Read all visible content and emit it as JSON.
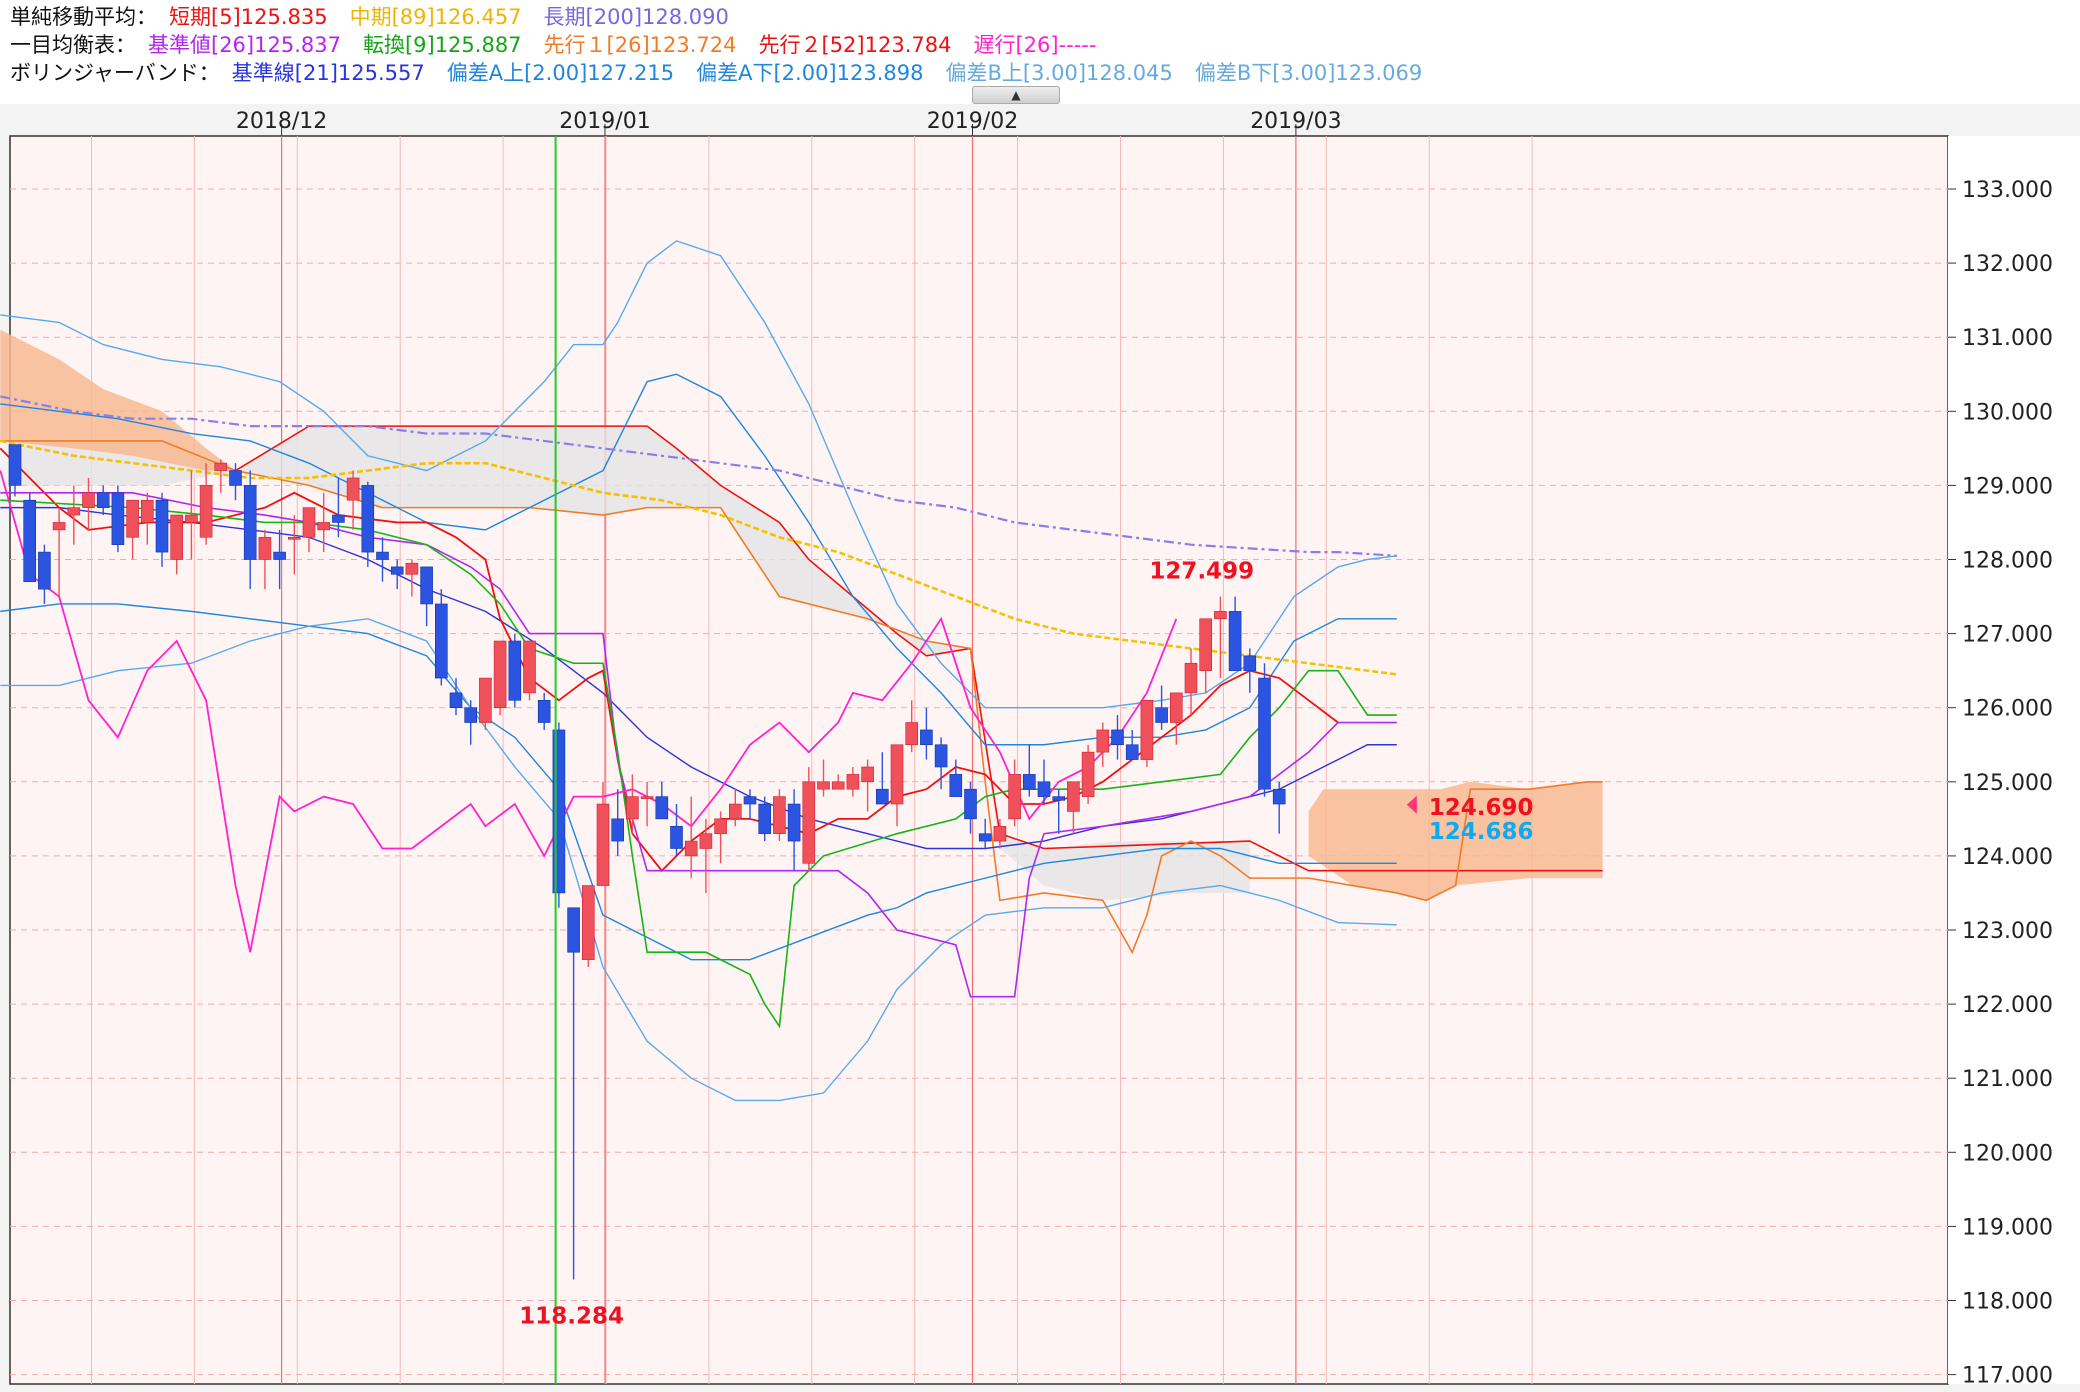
{
  "header": {
    "sma": {
      "label": "単純移動平均：",
      "short": "短期[5]125.835",
      "mid": "中期[89]126.457",
      "long": "長期[200]128.090"
    },
    "ichimoku": {
      "label": "一目均衡表：",
      "kijun": "基準値[26]125.837",
      "tenkan": "転換[9]125.887",
      "senkou1": "先行１[26]123.724",
      "senkou2": "先行２[52]123.784",
      "chikou": "遅行[26]-----"
    },
    "bollinger": {
      "label": "ボリンジャーバンド：",
      "base": "基準線[21]125.557",
      "a_up": "偏差A上[2.00]127.215",
      "a_down": "偏差A下[2.00]123.898",
      "b_up": "偏差B上[3.00]128.045",
      "b_down": "偏差B下[3.00]123.069"
    }
  },
  "colors": {
    "up": "#f0505a",
    "down": "#2b55e0",
    "sma_short": "#ee1111",
    "sma_mid": "#f5c000",
    "sma_long": "#8a7ee8",
    "kijun": "#b226ee",
    "tenkan": "#16b516",
    "senkou1": "#f07b28",
    "senkou2": "#ee1111",
    "chikou": "#ff22cc",
    "bb_base": "#2b33dd",
    "bb_a": "#1f86dd",
    "bb_b": "#55aaee",
    "cloud_bull": "#f8b890",
    "cloud_bear": "#e4e4e4",
    "bg": "#fff4f4",
    "grid": "#f4aaaa",
    "vline": "#f07070",
    "marker": "#22cc22",
    "lbl_red": "#ee1122",
    "lbl_cyan": "#11aaee"
  },
  "chart_data": {
    "type": "candlestick",
    "ylim": [
      117,
      133.5
    ],
    "yticks": [
      "117.000",
      "118.000",
      "119.000",
      "120.000",
      "121.000",
      "122.000",
      "123.000",
      "124.000",
      "125.000",
      "126.000",
      "127.000",
      "128.000",
      "129.000",
      "130.000",
      "131.000",
      "132.000",
      "133.000"
    ],
    "xlabels": [
      {
        "label": "2018/12",
        "index": 18
      },
      {
        "label": "2019/01",
        "index": 40
      },
      {
        "label": "2019/02",
        "index": 65
      },
      {
        "label": "2019/03",
        "index": 87
      }
    ],
    "n_slots": 109,
    "candles": [
      [
        129.55,
        129.55,
        128.85,
        129.0
      ],
      [
        128.8,
        128.9,
        127.8,
        127.7
      ],
      [
        128.1,
        128.2,
        127.4,
        127.6
      ],
      [
        128.4,
        128.7,
        127.5,
        128.5
      ],
      [
        128.6,
        129.0,
        128.2,
        128.7
      ],
      [
        128.7,
        129.1,
        128.4,
        128.9
      ],
      [
        128.9,
        129.0,
        128.6,
        128.7
      ],
      [
        128.9,
        129.0,
        128.1,
        128.2
      ],
      [
        128.3,
        128.8,
        128.0,
        128.8
      ],
      [
        128.5,
        128.9,
        128.2,
        128.8
      ],
      [
        128.8,
        128.9,
        127.9,
        128.1
      ],
      [
        128.0,
        128.5,
        127.8,
        128.6
      ],
      [
        128.5,
        129.2,
        128.0,
        128.6
      ],
      [
        128.3,
        129.3,
        128.2,
        129.0
      ],
      [
        129.2,
        129.35,
        128.9,
        129.3
      ],
      [
        129.2,
        129.3,
        128.8,
        129.0
      ],
      [
        129.0,
        129.2,
        127.6,
        128.0
      ],
      [
        128.0,
        128.4,
        127.6,
        128.3
      ],
      [
        128.1,
        128.4,
        127.6,
        128.0
      ],
      [
        128.3,
        128.6,
        127.8,
        128.3
      ],
      [
        128.3,
        128.7,
        128.1,
        128.7
      ],
      [
        128.4,
        128.9,
        128.1,
        128.5
      ],
      [
        128.6,
        129.1,
        128.3,
        128.5
      ],
      [
        128.8,
        129.2,
        128.4,
        129.1
      ],
      [
        129.0,
        129.05,
        127.9,
        128.1
      ],
      [
        128.1,
        128.3,
        127.7,
        128.0
      ],
      [
        127.9,
        128.0,
        127.6,
        127.8
      ],
      [
        127.8,
        128.0,
        127.5,
        127.95
      ],
      [
        127.9,
        127.9,
        127.1,
        127.4
      ],
      [
        127.4,
        127.6,
        126.3,
        126.4
      ],
      [
        126.2,
        126.4,
        125.9,
        126.0
      ],
      [
        126.0,
        126.1,
        125.5,
        125.8
      ],
      [
        125.8,
        126.4,
        125.7,
        126.4
      ],
      [
        126.0,
        126.9,
        125.9,
        126.9
      ],
      [
        126.9,
        127.0,
        126.0,
        126.1
      ],
      [
        126.2,
        126.9,
        126.1,
        126.9
      ],
      [
        126.1,
        126.2,
        125.7,
        125.8
      ],
      [
        125.7,
        125.8,
        123.3,
        123.5
      ],
      [
        123.3,
        123.3,
        118.284,
        122.7
      ],
      [
        122.6,
        123.6,
        122.5,
        123.6
      ],
      [
        123.6,
        125.0,
        123.6,
        124.7
      ],
      [
        124.5,
        124.9,
        124.0,
        124.2
      ],
      [
        124.5,
        125.1,
        124.3,
        124.8
      ],
      [
        124.8,
        125.0,
        124.4,
        124.8
      ],
      [
        124.8,
        125.0,
        124.6,
        124.5
      ],
      [
        124.4,
        124.7,
        124.0,
        124.1
      ],
      [
        124.0,
        124.8,
        123.7,
        124.2
      ],
      [
        124.1,
        124.5,
        123.5,
        124.3
      ],
      [
        124.3,
        124.6,
        123.9,
        124.5
      ],
      [
        124.5,
        124.9,
        124.4,
        124.7
      ],
      [
        124.8,
        124.9,
        124.5,
        124.7
      ],
      [
        124.7,
        124.8,
        124.2,
        124.3
      ],
      [
        124.3,
        124.9,
        124.2,
        124.8
      ],
      [
        124.7,
        124.9,
        123.8,
        124.2
      ],
      [
        123.9,
        125.2,
        123.8,
        125.0
      ],
      [
        124.9,
        125.3,
        124.8,
        125.0
      ],
      [
        124.9,
        125.1,
        124.9,
        125.0
      ],
      [
        124.9,
        125.2,
        124.8,
        125.1
      ],
      [
        125.0,
        125.3,
        124.6,
        125.2
      ],
      [
        124.9,
        125.4,
        124.7,
        124.7
      ],
      [
        124.7,
        125.5,
        124.4,
        125.5
      ],
      [
        125.5,
        126.1,
        125.4,
        125.8
      ],
      [
        125.7,
        126.0,
        125.3,
        125.5
      ],
      [
        125.5,
        125.6,
        124.9,
        125.2
      ],
      [
        125.1,
        125.3,
        124.8,
        124.8
      ],
      [
        124.9,
        125.0,
        124.3,
        124.5
      ],
      [
        124.3,
        124.5,
        124.1,
        124.2
      ],
      [
        124.2,
        124.5,
        124.1,
        124.4
      ],
      [
        124.5,
        125.3,
        124.4,
        125.1
      ],
      [
        125.1,
        125.5,
        124.8,
        124.9
      ],
      [
        125.0,
        125.3,
        124.7,
        124.8
      ],
      [
        124.8,
        124.9,
        124.3,
        124.75
      ],
      [
        124.6,
        125.0,
        124.3,
        125.0
      ],
      [
        124.8,
        125.5,
        124.7,
        125.4
      ],
      [
        125.4,
        125.8,
        125.2,
        125.7
      ],
      [
        125.7,
        125.9,
        125.3,
        125.5
      ],
      [
        125.5,
        125.7,
        125.3,
        125.3
      ],
      [
        125.3,
        126.0,
        125.2,
        126.1
      ],
      [
        126.0,
        126.3,
        125.7,
        125.8
      ],
      [
        125.8,
        126.2,
        125.5,
        126.2
      ],
      [
        126.2,
        126.8,
        125.9,
        126.6
      ],
      [
        126.5,
        127.0,
        126.2,
        127.2
      ],
      [
        127.2,
        127.5,
        126.4,
        127.3
      ],
      [
        127.3,
        127.5,
        126.5,
        126.5
      ],
      [
        126.7,
        126.8,
        126.2,
        126.5
      ],
      [
        126.4,
        126.6,
        124.8,
        124.9
      ],
      [
        124.9,
        125.0,
        124.3,
        124.7
      ]
    ]
  },
  "labels": {
    "high": "127.499",
    "low": "118.284",
    "last_red": "124.690",
    "last_cyan": "124.686"
  }
}
